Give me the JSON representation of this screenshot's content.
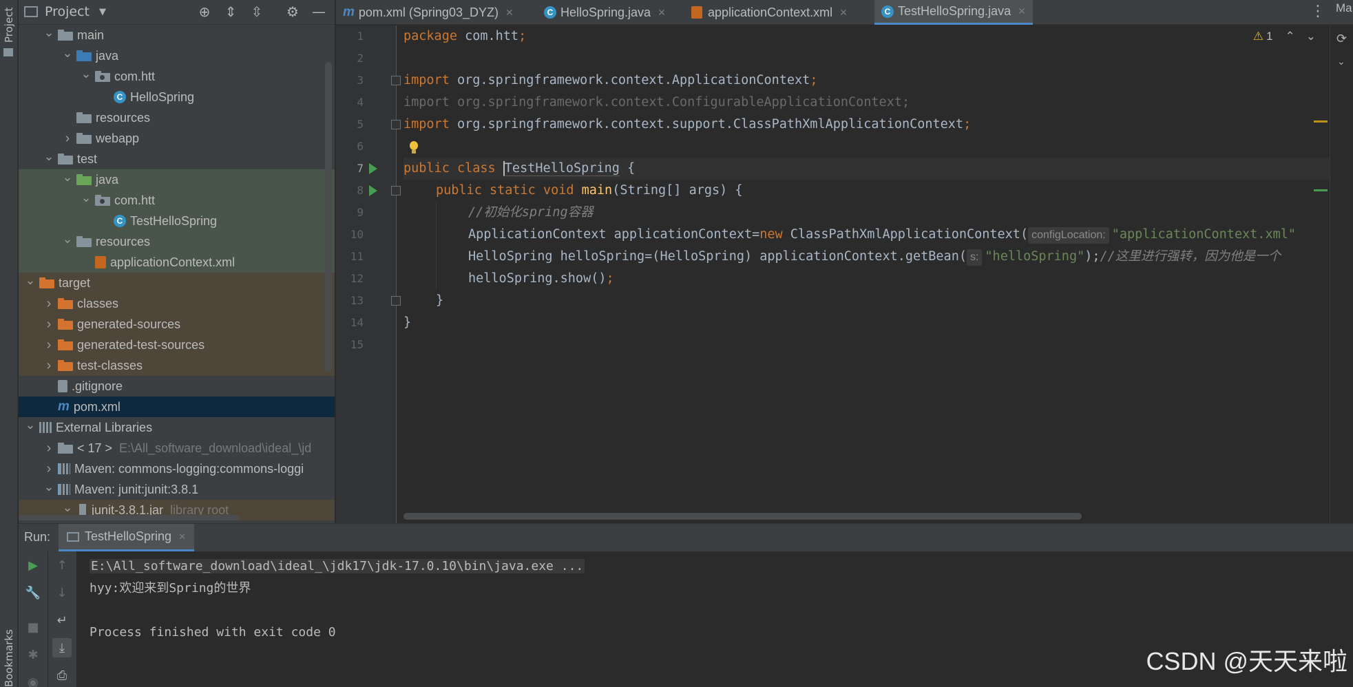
{
  "left_strip": {
    "project_label": "Project",
    "bookmarks_label": "Bookmarks"
  },
  "project_panel": {
    "title": "Project",
    "tree": [
      {
        "label": "main",
        "indent": 1,
        "icon": "folder",
        "chev": "down"
      },
      {
        "label": "java",
        "indent": 2,
        "icon": "folder-blue",
        "chev": "down"
      },
      {
        "label": "com.htt",
        "indent": 3,
        "icon": "package",
        "chev": "down"
      },
      {
        "label": "HelloSpring",
        "indent": 4,
        "icon": "class"
      },
      {
        "label": "resources",
        "indent": 2,
        "icon": "folder"
      },
      {
        "label": "webapp",
        "indent": 2,
        "icon": "folder-web",
        "chev": "right"
      },
      {
        "label": "test",
        "indent": 1,
        "icon": "folder",
        "chev": "down"
      },
      {
        "label": "java",
        "indent": 2,
        "icon": "folder-green",
        "chev": "down"
      },
      {
        "label": "com.htt",
        "indent": 3,
        "icon": "package",
        "chev": "down"
      },
      {
        "label": "TestHelloSpring",
        "indent": 4,
        "icon": "class"
      },
      {
        "label": "resources",
        "indent": 2,
        "icon": "folder",
        "chev": "down"
      },
      {
        "label": "applicationContext.xml",
        "indent": 3,
        "icon": "xml"
      },
      {
        "label": "target",
        "indent": 0,
        "icon": "folder-orange",
        "chev": "down"
      },
      {
        "label": "classes",
        "indent": 1,
        "icon": "folder-orange",
        "chev": "right"
      },
      {
        "label": "generated-sources",
        "indent": 1,
        "icon": "folder-orange",
        "chev": "right"
      },
      {
        "label": "generated-test-sources",
        "indent": 1,
        "icon": "folder-orange",
        "chev": "right"
      },
      {
        "label": "test-classes",
        "indent": 1,
        "icon": "folder-orange",
        "chev": "right"
      },
      {
        "label": ".gitignore",
        "indent": 1,
        "icon": "gitignore"
      },
      {
        "label": "pom.xml",
        "indent": 1,
        "icon": "maven"
      },
      {
        "label": "External Libraries",
        "indent": 0,
        "icon": "libs",
        "chev": "down"
      },
      {
        "label": "< 17 >",
        "indent": 1,
        "icon": "jdk",
        "chev": "right",
        "dim": "E:\\All_software_download\\ideal_\\jd"
      },
      {
        "label": "Maven: commons-logging:commons-loggi",
        "indent": 1,
        "icon": "lib",
        "chev": "right"
      },
      {
        "label": "Maven: junit:junit:3.8.1",
        "indent": 1,
        "icon": "lib",
        "chev": "down"
      },
      {
        "label": "junit-3.8.1.jar",
        "indent": 2,
        "icon": "jar",
        "chev": "down",
        "dim": "library root"
      }
    ]
  },
  "editor": {
    "tabs": [
      {
        "label": "pom.xml (Spring03_DYZ)",
        "icon": "m"
      },
      {
        "label": "HelloSpring.java",
        "icon": "c"
      },
      {
        "label": "applicationContext.xml",
        "icon": "xml"
      },
      {
        "label": "TestHelloSpring.java",
        "icon": "c"
      }
    ],
    "line_numbers": [
      "1",
      "2",
      "3",
      "4",
      "5",
      "6",
      "7",
      "8",
      "9",
      "10",
      "11",
      "12",
      "13",
      "14",
      "15"
    ],
    "warnings_count": "1",
    "code": {
      "l1_kw": "package",
      "l1_rest": " com.htt",
      "l1_semi": ";",
      "l3_kw": "import",
      "l3_rest": " org.springframework.context.ApplicationContext",
      "l3_semi": ";",
      "l4": "import org.springframework.context.ConfigurableApplicationContext;",
      "l5_kw": "import",
      "l5_rest": " org.springframework.context.support.ClassPathXmlApplicationContext",
      "l5_semi": ";",
      "l7_kw": "public class ",
      "l7_cls": "TestHelloSpring",
      "l7_rest": " {",
      "l8_kw": "public static void ",
      "l8_fn": "main",
      "l8_rest": "(String[] args) {",
      "l9": "//初始化spring容器",
      "l10_a": "ApplicationContext applicationContext=",
      "l10_kw": "new",
      "l10_b": " ClassPathXmlApplicationContext(",
      "l10_hint": "configLocation:",
      "l10_str": "\"applicationContext.xml\"",
      "l11_a": "HelloSpring helloSpring=(HelloSpring) applicationContext.getBean(",
      "l11_hint": "s:",
      "l11_str": "\"helloSpring\"",
      "l11_b": ");",
      "l11_cm": "//这里进行强转，因为他是一个",
      "l12_a": "helloSpring.show()",
      "l12_semi": ";",
      "l13": "}",
      "l14": "}"
    }
  },
  "run_panel": {
    "label": "Run:",
    "tab": "TestHelloSpring",
    "console": [
      "E:\\All_software_download\\ideal_\\jdk17\\jdk-17.0.10\\bin\\java.exe ...",
      "hyy:欢迎来到Spring的世界",
      "",
      "Process finished with exit code 0"
    ]
  },
  "watermark": "CSDN @天天来啦",
  "right_strip_label": "Ma"
}
